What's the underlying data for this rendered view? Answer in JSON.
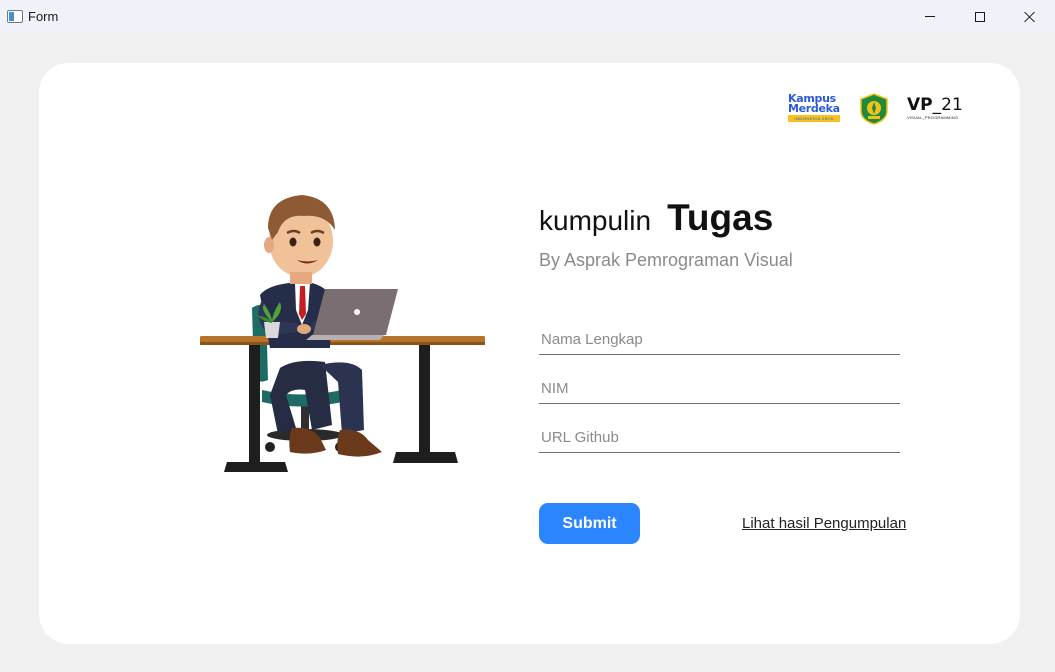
{
  "window": {
    "title": "Form",
    "icon": "app-window-icon",
    "controls": [
      "minimize-icon",
      "maximize-icon",
      "close-icon"
    ]
  },
  "logos": {
    "kampus_merdeka": {
      "line1": "Kampus",
      "line2": "Merdeka",
      "tagline": "INDONESIA JAYA"
    },
    "university": "university-emblem-icon",
    "vp": {
      "bold": "VP",
      "rest": "_21",
      "sub": "VISUAL_PROGRAMMING"
    }
  },
  "heading": {
    "prefix": "kumpulin",
    "main": "Tugas",
    "subtitle": "By Asprak Pemrograman Visual"
  },
  "form": {
    "nama_placeholder": "Nama Lengkap",
    "nim_placeholder": "NIM",
    "url_placeholder": "URL Github",
    "submit_label": "Submit",
    "results_link": "Lihat hasil Pengumpulan"
  },
  "colors": {
    "accent": "#2a85ff",
    "background": "#f0f0f0",
    "card": "#ffffff"
  }
}
